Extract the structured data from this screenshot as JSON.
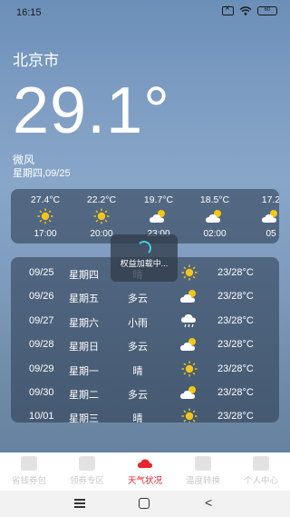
{
  "status": {
    "time": "16:15",
    "battery": "60"
  },
  "current": {
    "city": "北京市",
    "temperature": "29.1°",
    "wind": "微风",
    "date": "星期四,09/25"
  },
  "hourly": [
    {
      "temp": "27.4°C",
      "icon": "sunny-icon",
      "time": "17:00"
    },
    {
      "temp": "22.2°C",
      "icon": "sunny-icon",
      "time": "20:00"
    },
    {
      "temp": "19.7°C",
      "icon": "partly-cloudy-icon",
      "time": "23:00"
    },
    {
      "temp": "18.5°C",
      "icon": "partly-cloudy-icon",
      "time": "02:00"
    },
    {
      "temp": "17.2",
      "icon": "partly-cloudy-icon",
      "time": "05"
    }
  ],
  "loading": {
    "text": "权益加载中..."
  },
  "daily": [
    {
      "date": "09/25",
      "weekday": "星期四",
      "condition": "晴",
      "icon": "sunny-icon",
      "range": "23/28°C"
    },
    {
      "date": "09/26",
      "weekday": "星期五",
      "condition": "多云",
      "icon": "partly-cloudy-icon",
      "range": "23/28°C"
    },
    {
      "date": "09/27",
      "weekday": "星期六",
      "condition": "小雨",
      "icon": "rain-icon",
      "range": "23/28°C"
    },
    {
      "date": "09/28",
      "weekday": "星期日",
      "condition": "多云",
      "icon": "partly-cloudy-icon",
      "range": "23/28°C"
    },
    {
      "date": "09/29",
      "weekday": "星期一",
      "condition": "晴",
      "icon": "sunny-icon",
      "range": "23/28°C"
    },
    {
      "date": "09/30",
      "weekday": "星期二",
      "condition": "多云",
      "icon": "partly-cloudy-icon",
      "range": "23/28°C"
    },
    {
      "date": "10/01",
      "weekday": "星期三",
      "condition": "晴",
      "icon": "sunny-icon",
      "range": "23/28°C"
    }
  ],
  "tabs": [
    {
      "label": "省钱券包",
      "icon": "coupon-book-icon",
      "active": false
    },
    {
      "label": "领券专区",
      "icon": "coupon-tag-icon",
      "active": false
    },
    {
      "label": "天气状况",
      "icon": "weather-cloud-icon",
      "active": true
    },
    {
      "label": "温度转换",
      "icon": "temperature-convert-icon",
      "active": false
    },
    {
      "label": "个人中心",
      "icon": "user-icon",
      "active": false
    }
  ],
  "colors": {
    "accent": "#e8262b",
    "sun": "#f5c518",
    "spinner": "#40d0e0",
    "tab_inactive": "#c8c8c8"
  }
}
